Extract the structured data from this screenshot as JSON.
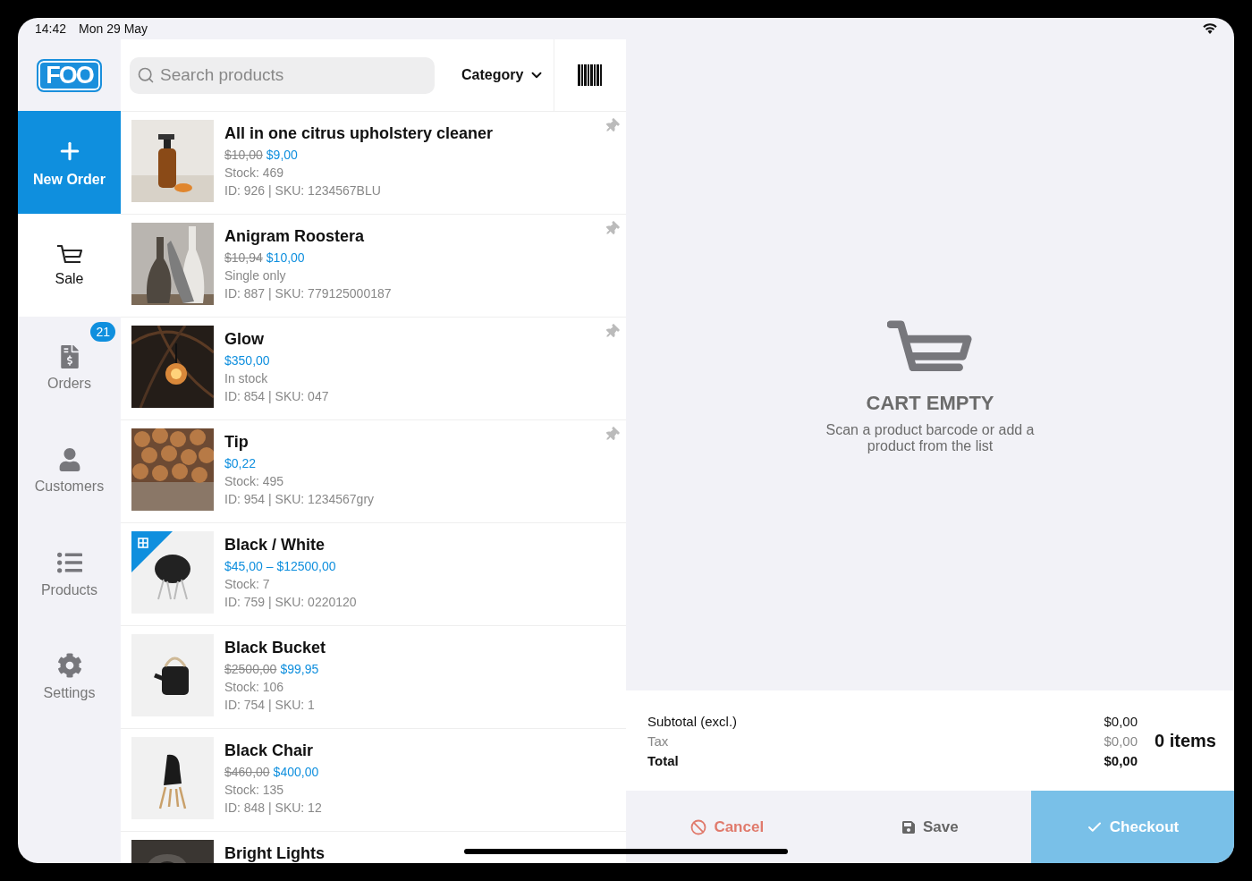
{
  "status_bar": {
    "time": "14:42",
    "date": "Mon 29 May"
  },
  "logo": {
    "text": "FOO"
  },
  "sidebar": {
    "items": [
      {
        "kind": "action",
        "label": "New Order"
      },
      {
        "kind": "nav",
        "label": "Sale",
        "selected": true
      },
      {
        "kind": "nav",
        "label": "Orders",
        "selected": false,
        "badge": "21"
      },
      {
        "kind": "nav",
        "label": "Customers",
        "selected": false
      },
      {
        "kind": "nav",
        "label": "Products",
        "selected": false
      },
      {
        "kind": "nav",
        "label": "Settings",
        "selected": false
      }
    ]
  },
  "search": {
    "placeholder": "Search products"
  },
  "category": {
    "label": "Category"
  },
  "products": [
    {
      "title": "All in one citrus upholstery cleaner",
      "regular_price": "$10,00",
      "price": "$9,00",
      "stock": "Stock: 469",
      "meta": "ID: 926 | SKU: 1234567BLU",
      "pinned": true,
      "variation": false
    },
    {
      "title": "Anigram Roostera",
      "regular_price": "$10,94",
      "price": "$10,00",
      "stock": "Single only",
      "meta": "ID: 887 | SKU: 779125000187",
      "pinned": true,
      "variation": false
    },
    {
      "title": "Glow",
      "price": "$350,00",
      "stock": "In stock",
      "meta": "ID: 854 | SKU: 047",
      "pinned": true,
      "variation": false
    },
    {
      "title": "Tip",
      "price": "$0,22",
      "stock": "Stock: 495",
      "meta": "ID: 954 | SKU: 1234567gry",
      "pinned": true,
      "variation": false
    },
    {
      "title": "Black / White",
      "price": "$45,00 – $12500,00",
      "stock": "Stock: 7",
      "meta": "ID: 759 | SKU: 0220120",
      "pinned": false,
      "variation": true
    },
    {
      "title": "Black Bucket",
      "regular_price": "$2500,00",
      "price": "$99,95",
      "stock": "Stock: 106",
      "meta": "ID: 754 | SKU: 1",
      "pinned": false,
      "variation": false
    },
    {
      "title": "Black Chair",
      "regular_price": "$460,00",
      "price": "$400,00",
      "stock": "Stock: 135",
      "meta": "ID: 848 | SKU: 12",
      "pinned": false,
      "variation": false
    },
    {
      "title": "Bright Lights",
      "pinned": false,
      "variation": false
    }
  ],
  "cart": {
    "title": "CART EMPTY",
    "message": "Scan a product barcode or add a product from the list"
  },
  "totals": {
    "rows": [
      {
        "kind": "normal",
        "label": "Subtotal (excl.)",
        "value": "$0,00"
      },
      {
        "kind": "muted",
        "label": "Tax",
        "value": "$0,00"
      },
      {
        "kind": "bold",
        "label": "Total",
        "value": "$0,00"
      }
    ],
    "items": "0 items"
  },
  "actions": [
    {
      "kind": "cancel",
      "label": "Cancel"
    },
    {
      "kind": "save",
      "label": "Save"
    },
    {
      "kind": "checkout",
      "label": "Checkout"
    }
  ]
}
